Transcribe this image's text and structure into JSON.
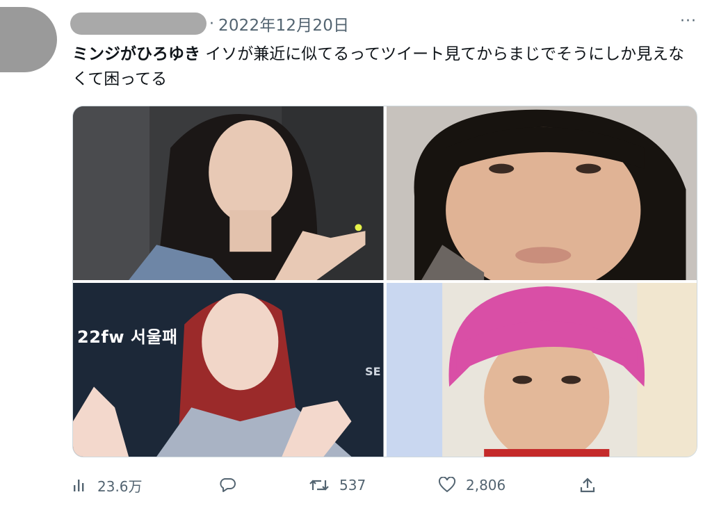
{
  "tweet": {
    "date": "2022年12月20日",
    "separator": "·",
    "more": "···",
    "text_bold": "ミンジがひろゆき",
    "text_rest": " イソが兼近に似てるってツイート見てからまじでそうにしか見えなくて困ってる",
    "image_caption": "22fw 서울패",
    "image_partial_text": "SE"
  },
  "actions": {
    "views": "23.6万",
    "replies": "",
    "retweets": "537",
    "likes": "2,806"
  },
  "colors": {
    "text": "#0f1419",
    "muted": "#536471",
    "redaction": "#a9a9a9",
    "avatar": "#9a9a9a"
  },
  "icons": [
    "views-icon",
    "reply-icon",
    "retweet-icon",
    "like-icon",
    "share-icon",
    "more-icon"
  ]
}
